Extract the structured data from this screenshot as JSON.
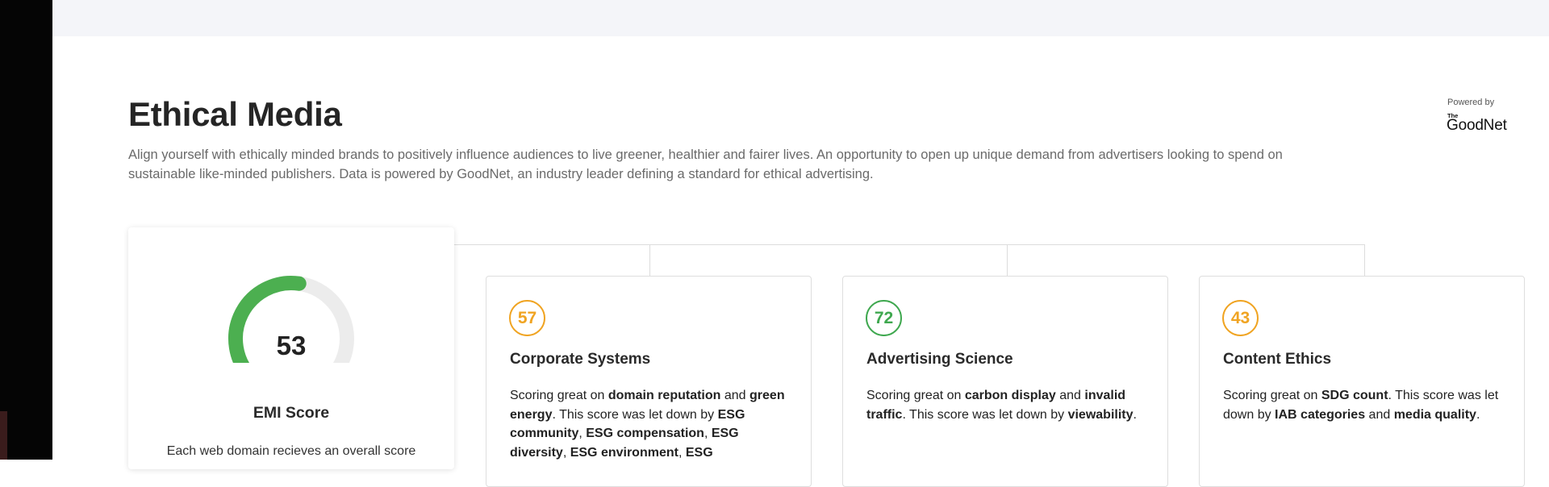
{
  "header": {
    "title": "Ethical Media",
    "description": "Align yourself with ethically minded brands to positively influence audiences to live greener, healthier and fairer lives. An opportunity to open up unique demand from advertisers looking to spend on sustainable like-minded publishers. Data is powered by GoodNet, an industry leader defining a standard for ethical advertising."
  },
  "powered_by": {
    "label": "Powered by",
    "logo_prefix": "The",
    "logo_text": "GoodNet"
  },
  "emi": {
    "score": "53",
    "score_fraction": 0.53,
    "title": "EMI Score",
    "description": "Each web domain recieves an overall score",
    "color": "#4caf50"
  },
  "cards": [
    {
      "score": "57",
      "score_color": "#f0a422",
      "title": "Corporate Systems",
      "text": {
        "t0": "Scoring great on ",
        "b0": "domain reputation",
        "t1": " and ",
        "b1": "green energy",
        "t2": ". This score was let down by ",
        "b2": "ESG community",
        "t3": ", ",
        "b3": "ESG compensation",
        "t4": ", ",
        "b4": "ESG diversity",
        "t5": ", ",
        "b5": "ESG environment",
        "t6": ", ",
        "b6": "ESG"
      }
    },
    {
      "score": "72",
      "score_color": "#3fa84f",
      "title": "Advertising Science",
      "text": {
        "t0": "Scoring great on ",
        "b0": "carbon display",
        "t1": " and ",
        "b1": "invalid traffic",
        "t2": ". This score was let down by ",
        "b2": "viewability",
        "t3": "."
      }
    },
    {
      "score": "43",
      "score_color": "#f0a422",
      "title": "Content Ethics",
      "text": {
        "t0": "Scoring great on ",
        "b0": "SDG count",
        "t1": ". This score was let down by ",
        "b1": "IAB categories",
        "t2": " and ",
        "b2": "media quality",
        "t3": "."
      }
    }
  ]
}
